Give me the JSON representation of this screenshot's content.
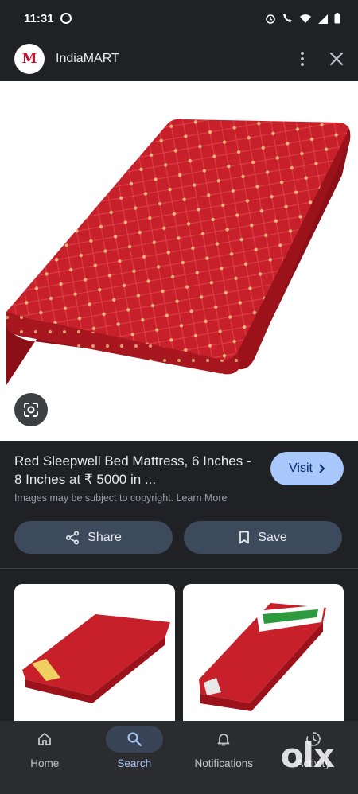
{
  "status_bar": {
    "time": "11:31",
    "icons": [
      "whatsapp-icon",
      "alarm-icon",
      "wifi-call-icon",
      "wifi-icon",
      "signal-icon",
      "battery-icon"
    ]
  },
  "header": {
    "site_logo_text": "M",
    "site_name": "IndiaMART",
    "menu_icon": "more-vert-icon",
    "close_icon": "close-icon"
  },
  "result": {
    "title": "Red Sleepwell Bed Mattress, 6 Inches - 8 Inches at ₹ 5000 in ...",
    "visit_label": "Visit",
    "copyright_note": "Images may be subject to copyright. Learn More",
    "share_label": "Share",
    "save_label": "Save",
    "colors": {
      "visit_bg": "#a8c7fa",
      "action_bg": "#3c4a5c",
      "mattress_red": "#c8202a"
    }
  },
  "related": [
    {
      "label_icon": "mattress-thumbnail"
    },
    {
      "label_icon": "mattress-thumbnail"
    }
  ],
  "bottom_nav": [
    {
      "label": "Home",
      "icon": "home-icon",
      "active": false
    },
    {
      "label": "Search",
      "icon": "search-icon",
      "active": true
    },
    {
      "label": "Notifications",
      "icon": "bell-icon",
      "active": false
    },
    {
      "label": "Activity",
      "icon": "activity-icon",
      "active": false
    }
  ],
  "watermark": "olx"
}
